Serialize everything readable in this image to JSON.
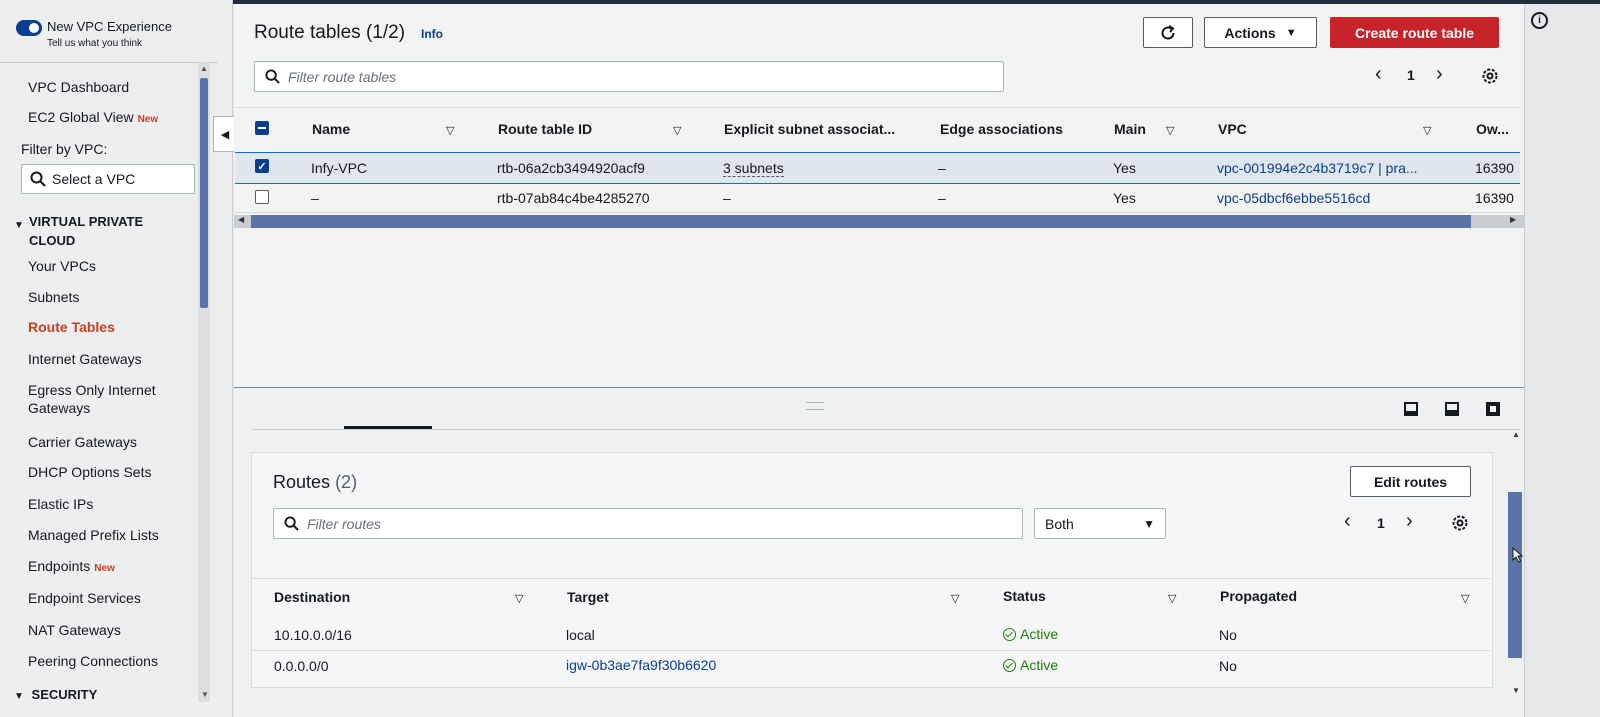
{
  "sidebar": {
    "new_experience_title": "New VPC Experience",
    "new_experience_sub": "Tell us what you think",
    "top_items": [
      {
        "label": "VPC Dashboard",
        "badge": ""
      },
      {
        "label": "EC2 Global View",
        "badge": "New"
      }
    ],
    "filter_label": "Filter by VPC:",
    "filter_placeholder": "Select a VPC",
    "section_vpc": "VIRTUAL PRIVATE CLOUD",
    "section_vpc_line1": "VIRTUAL PRIVATE",
    "section_vpc_line2": "CLOUD",
    "vpc_items": [
      {
        "label": "Your VPCs",
        "badge": ""
      },
      {
        "label": "Subnets",
        "badge": ""
      },
      {
        "label": "Route Tables",
        "badge": "",
        "active": true
      },
      {
        "label": "Internet Gateways",
        "badge": ""
      },
      {
        "label": "Egress Only Internet Gateways",
        "badge": ""
      },
      {
        "label": "Carrier Gateways",
        "badge": ""
      },
      {
        "label": "DHCP Options Sets",
        "badge": ""
      },
      {
        "label": "Elastic IPs",
        "badge": ""
      },
      {
        "label": "Managed Prefix Lists",
        "badge": ""
      },
      {
        "label": "Endpoints",
        "badge": "New"
      },
      {
        "label": "Endpoint Services",
        "badge": ""
      },
      {
        "label": "NAT Gateways",
        "badge": ""
      },
      {
        "label": "Peering Connections",
        "badge": ""
      }
    ],
    "section_security": "SECURITY"
  },
  "route_tables": {
    "title": "Route tables",
    "count": "(1/2)",
    "info": "Info",
    "actions_label": "Actions",
    "create_label": "Create route table",
    "filter_placeholder": "Filter route tables",
    "page": "1",
    "columns": [
      "Name",
      "Route table ID",
      "Explicit subnet associat...",
      "Edge associations",
      "Main",
      "VPC",
      "Ow..."
    ],
    "rows": [
      {
        "selected": true,
        "name": "Infy-VPC",
        "id": "rtb-06a2cb3494920acf9",
        "explicit": "3 subnets",
        "edge": "–",
        "main": "Yes",
        "vpc": "vpc-001994e2c4b3719c7 | pra...",
        "owner": "16390"
      },
      {
        "selected": false,
        "name": "–",
        "id": "rtb-07ab84c4be4285270",
        "explicit": "–",
        "edge": "–",
        "main": "Yes",
        "vpc": "vpc-05dbcf6ebbe5516cd",
        "owner": "16390"
      }
    ]
  },
  "routes": {
    "title": "Routes",
    "count": "(2)",
    "edit_label": "Edit routes",
    "filter_placeholder": "Filter routes",
    "filter_select": "Both",
    "page": "1",
    "columns": [
      "Destination",
      "Target",
      "Status",
      "Propagated"
    ],
    "rows": [
      {
        "destination": "10.10.0.0/16",
        "target": "local",
        "target_link": false,
        "status": "Active",
        "propagated": "No"
      },
      {
        "destination": "0.0.0.0/0",
        "target": "igw-0b3ae7fa9f30b6620",
        "target_link": true,
        "status": "Active",
        "propagated": "No"
      }
    ]
  },
  "colors": {
    "accent": "#0b3d91",
    "primary_button": "#c8232a",
    "active_nav": "#c7411f",
    "status_ok": "#1d8102"
  }
}
